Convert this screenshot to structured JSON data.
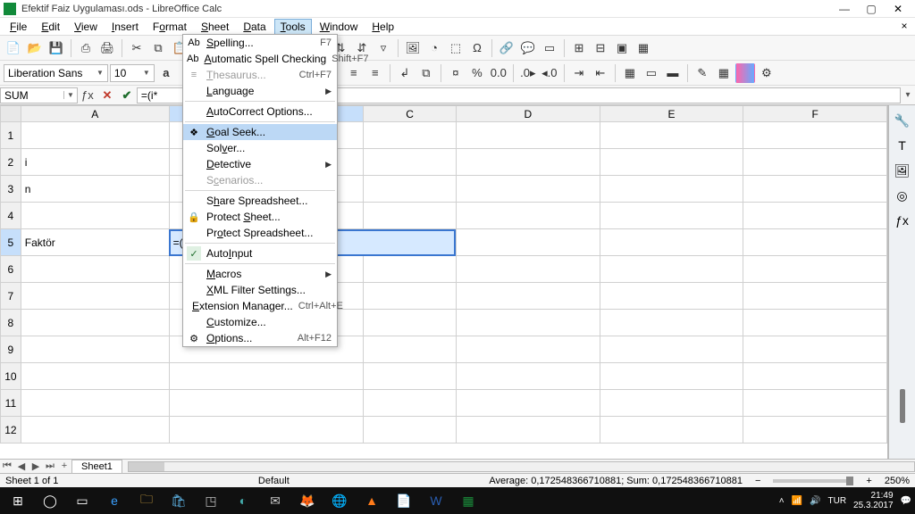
{
  "window": {
    "title": "Efektif Faiz Uygulaması.ods - LibreOffice Calc",
    "min": "—",
    "max": "▢",
    "close": "✕",
    "doc_close": "×"
  },
  "menubar": [
    {
      "label": "File",
      "u": "F"
    },
    {
      "label": "Edit",
      "u": "E"
    },
    {
      "label": "View",
      "u": "V"
    },
    {
      "label": "Insert",
      "u": "I"
    },
    {
      "label": "Format",
      "u": "o"
    },
    {
      "label": "Sheet",
      "u": "S"
    },
    {
      "label": "Data",
      "u": "D"
    },
    {
      "label": "Tools",
      "u": "T",
      "open": true
    },
    {
      "label": "Window",
      "u": "W"
    },
    {
      "label": "Help",
      "u": "H"
    }
  ],
  "formatting": {
    "font_name": "Liberation Sans",
    "font_size": "10"
  },
  "formula_bar": {
    "name_box": "SUM",
    "input": "=(i*"
  },
  "columns": [
    "A",
    "B",
    "C",
    "D",
    "E",
    "F"
  ],
  "rows": [
    "1",
    "2",
    "3",
    "4",
    "5",
    "6",
    "7",
    "8",
    "9",
    "10",
    "11",
    "12"
  ],
  "active": {
    "col": "B",
    "row": "5"
  },
  "cells": {
    "A2": "i",
    "A3": "n",
    "A5": "Faktör",
    "B5_overflow": "=(                         n-1)"
  },
  "tools_menu": {
    "items": [
      {
        "type": "item",
        "icon": "Ab",
        "label": "Spelling...",
        "u": "S",
        "accel": "F7"
      },
      {
        "type": "item",
        "icon": "Ab",
        "label": "Automatic Spell Checking",
        "u": "A",
        "accel": "Shift+F7"
      },
      {
        "type": "item",
        "icon": "≡",
        "label": "Thesaurus...",
        "u": "T",
        "accel": "Ctrl+F7",
        "disabled": true
      },
      {
        "type": "item",
        "label": "Language",
        "u": "L",
        "submenu": true
      },
      {
        "type": "sep"
      },
      {
        "type": "item",
        "label": "AutoCorrect Options...",
        "u": "A"
      },
      {
        "type": "sep"
      },
      {
        "type": "item",
        "icon": "❖",
        "label": "Goal Seek...",
        "u": "G",
        "highlight": true
      },
      {
        "type": "item",
        "label": "Solver...",
        "u": "v"
      },
      {
        "type": "item",
        "label": "Detective",
        "u": "D",
        "submenu": true
      },
      {
        "type": "item",
        "label": "Scenarios...",
        "u": "c",
        "disabled": true
      },
      {
        "type": "sep"
      },
      {
        "type": "item",
        "label": "Share Spreadsheet...",
        "u": "h"
      },
      {
        "type": "item",
        "icon": "🔒",
        "label": "Protect Sheet...",
        "u": "S"
      },
      {
        "type": "item",
        "label": "Protect Spreadsheet...",
        "u": "o"
      },
      {
        "type": "sep"
      },
      {
        "type": "item",
        "icon": "✓",
        "label": "AutoInput",
        "u": "I",
        "check": true
      },
      {
        "type": "sep"
      },
      {
        "type": "item",
        "label": "Macros",
        "u": "M",
        "submenu": true
      },
      {
        "type": "item",
        "label": "XML Filter Settings...",
        "u": "X"
      },
      {
        "type": "item",
        "label": "Extension Manager...",
        "u": "E",
        "accel": "Ctrl+Alt+E"
      },
      {
        "type": "item",
        "label": "Customize...",
        "u": "C"
      },
      {
        "type": "item",
        "icon": "⚙",
        "label": "Options...",
        "u": "O",
        "accel": "Alt+F12"
      }
    ]
  },
  "sheet_tabs": {
    "nav": [
      "⏮",
      "◀",
      "▶",
      "⏭",
      "+"
    ],
    "active": "Sheet1"
  },
  "statusbar": {
    "sheet": "Sheet 1 of 1",
    "style": "Default",
    "summary": "Average: 0,172548366710881; Sum: 0,172548366710881",
    "zoom": "250%"
  },
  "taskbar": {
    "time": "21:49",
    "date": "25.3.2017",
    "lang": "TUR"
  }
}
